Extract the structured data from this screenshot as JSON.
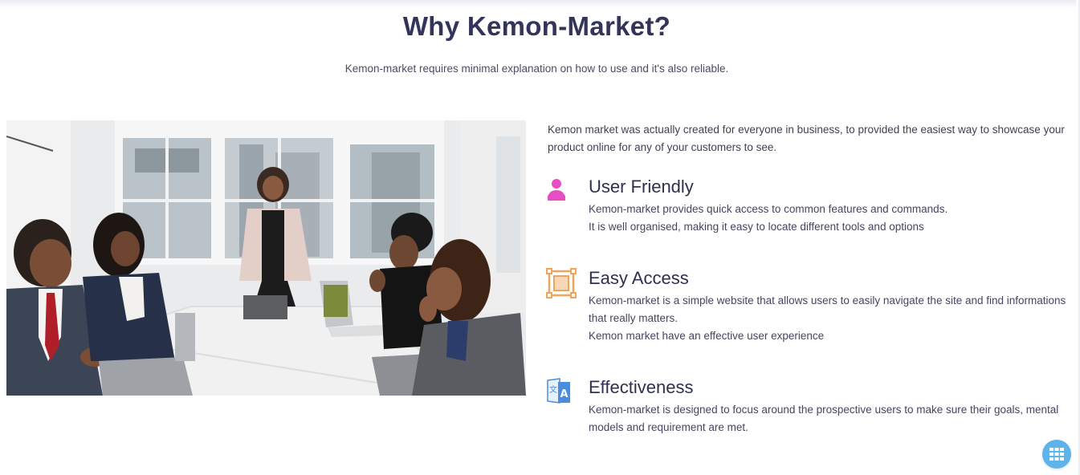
{
  "section": {
    "title": "Why Kemon-Market?",
    "subtitle": "Kemon-market requires minimal explanation on how to use and it's also reliable."
  },
  "image": {
    "description_icon": "team-meeting-photo"
  },
  "intro": "Kemon market was actually created for everyone in business, to provided the easiest way to showcase your product online for any of your customers to see.",
  "features": [
    {
      "icon": "user-icon",
      "icon_color": "#e84ec4",
      "title": "User Friendly",
      "lines": [
        "Kemon-market provides quick access to common features and commands.",
        "It is well organised, making it easy to locate different tools and options"
      ]
    },
    {
      "icon": "expand-box-icon",
      "icon_color": "#f0a45c",
      "title": "Easy Access",
      "lines": [
        "Kemon-market is a simple website that allows users to easily navigate the site and find informations that really matters.",
        "Kemon market have an effective user experience"
      ]
    },
    {
      "icon": "translate-icon",
      "icon_color": "#4a8de0",
      "title": "Effectiveness",
      "lines": [
        "Kemon-market is designed to focus around the prospective users to make sure their goals, mental",
        "models and requirement are met."
      ]
    }
  ],
  "floating_button": {
    "icon": "grid-apps-icon",
    "color": "#5db3ea"
  }
}
